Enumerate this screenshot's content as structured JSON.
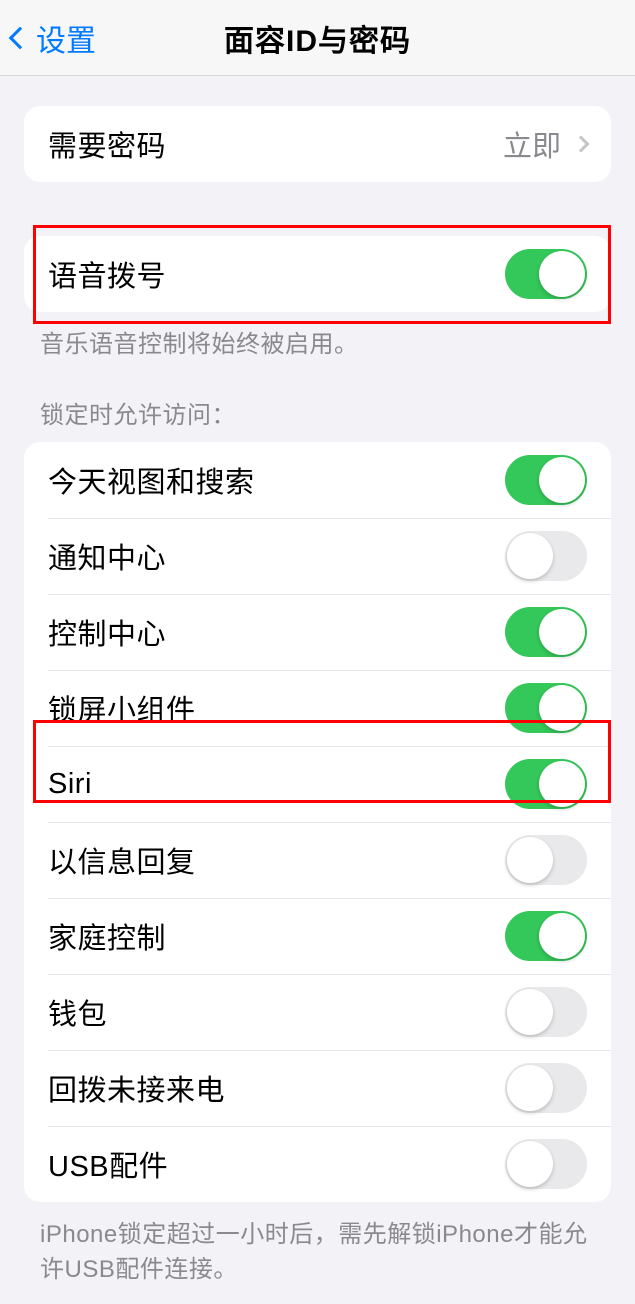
{
  "nav": {
    "back": "设置",
    "title": "面容ID与密码"
  },
  "passcode": {
    "label": "需要密码",
    "value": "立即"
  },
  "voice_dial": {
    "label": "语音拨号",
    "on": true,
    "footer": "音乐语音控制将始终被启用。"
  },
  "lock_section": {
    "header": "锁定时允许访问：",
    "items": [
      {
        "label": "今天视图和搜索",
        "on": true
      },
      {
        "label": "通知中心",
        "on": false
      },
      {
        "label": "控制中心",
        "on": true
      },
      {
        "label": "锁屏小组件",
        "on": true
      },
      {
        "label": "Siri",
        "on": true
      },
      {
        "label": "以信息回复",
        "on": false
      },
      {
        "label": "家庭控制",
        "on": true
      },
      {
        "label": "钱包",
        "on": false
      },
      {
        "label": "回拨未接来电",
        "on": false
      },
      {
        "label": "USB配件",
        "on": false
      }
    ],
    "footer": "iPhone锁定超过一小时后，需先解锁iPhone才能允许USB配件连接。"
  }
}
